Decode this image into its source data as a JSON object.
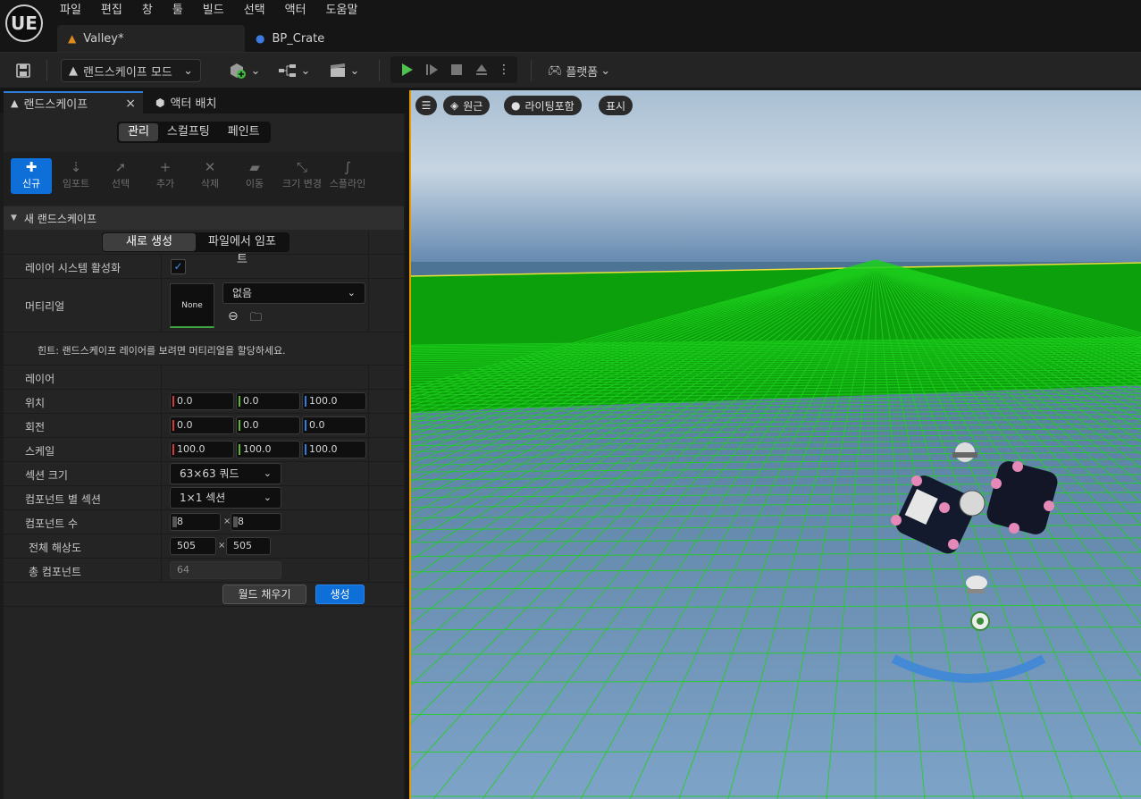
{
  "app": {
    "logo": "UE"
  },
  "menu": [
    "파일",
    "편집",
    "창",
    "툴",
    "빌드",
    "선택",
    "액터",
    "도움말"
  ],
  "doc_tabs": [
    {
      "label": "Valley*",
      "icon": "landscape-icon"
    },
    {
      "label": "BP_Crate",
      "icon": "blueprint-icon"
    }
  ],
  "toolbar": {
    "mode_label": "랜드스케이프 모드",
    "platform_label": "플랫폼"
  },
  "panel": {
    "tab_landscape": "랜드스케이프",
    "tab_place_actors": "액터 배치",
    "close_glyph": "×",
    "modes": [
      "관리",
      "스컬프팅",
      "페인트"
    ],
    "tools": [
      "신규",
      "임포트",
      "선택",
      "추가",
      "삭제",
      "이동",
      "크기 변경",
      "스플라인"
    ],
    "section_title": "새 랜드스케이프",
    "create_modes": [
      "새로 생성",
      "파일에서 임포트"
    ],
    "layer_system_label": "레이어 시스템 활성화",
    "layer_system_checked": true,
    "material_label": "머티리얼",
    "material_thumb": "None",
    "material_value": "없음",
    "hint": "힌트: 랜드스케이프 레이어를 보려면 머티리얼을 할당하세요.",
    "layers_label": "레이어",
    "location_label": "위치",
    "location": [
      "0.0",
      "0.0",
      "100.0"
    ],
    "rotation_label": "회전",
    "rotation": [
      "0.0",
      "0.0",
      "0.0"
    ],
    "scale_label": "스케일",
    "scale": [
      "100.0",
      "100.0",
      "100.0"
    ],
    "section_size_label": "섹션 크기",
    "section_size": "63×63 쿼드",
    "sections_per_component_label": "컴포넌트 별 섹션",
    "sections_per_component": "1×1 섹션",
    "component_count_label": "컴포넌트 수",
    "component_count": [
      "8",
      "8"
    ],
    "resolution_label": "전체 해상도",
    "resolution": [
      "505",
      "505"
    ],
    "total_components_label": "총 컴포넌트",
    "total_components": "64",
    "times_glyph": "×",
    "fill_world_button": "월드 채우기",
    "create_button": "생성"
  },
  "viewport": {
    "menu_glyph": "☰",
    "perspective_label": "원근",
    "lit_label": "라이팅포함",
    "show_label": "표시"
  },
  "colors": {
    "accent_blue": "#0e6fd8",
    "axis_x": "#d43a3a",
    "axis_y": "#5cb82a",
    "axis_z": "#2f7be0",
    "viewport_border": "#e69a00"
  }
}
